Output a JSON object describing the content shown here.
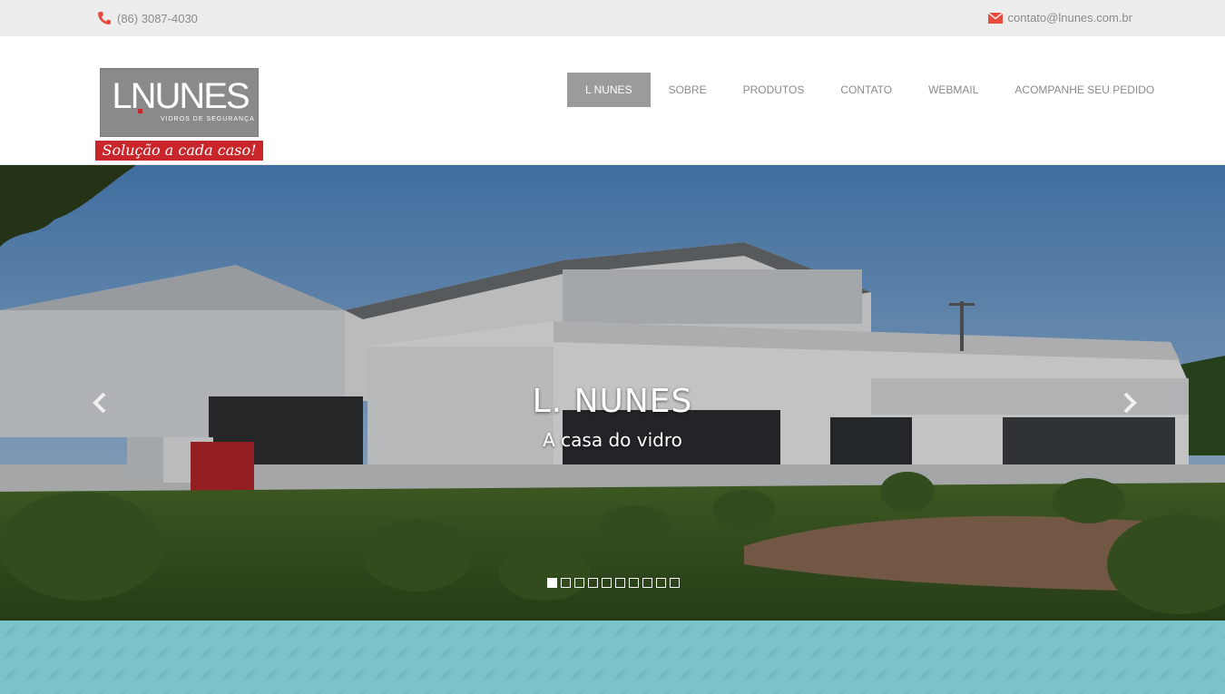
{
  "topbar": {
    "phone": "(86) 3087-4030",
    "phone_icon": "phone-icon",
    "email": "contato@lnunes.com.br",
    "email_icon": "envelope-icon"
  },
  "logo": {
    "word": "LNUNES",
    "subtitle": "VIDROS DE SEGURANÇA",
    "tagline": "Solução a cada caso!",
    "colors": {
      "grey": "#8a8a8a",
      "red": "#c9262b"
    }
  },
  "nav": {
    "items": [
      {
        "label": "L NUNES",
        "active": true
      },
      {
        "label": "SOBRE",
        "active": false
      },
      {
        "label": "PRODUTOS",
        "active": false
      },
      {
        "label": "CONTATO",
        "active": false
      },
      {
        "label": "WEBMAIL",
        "active": false
      },
      {
        "label": "ACOMPANHE SEU PEDIDO",
        "active": false
      }
    ],
    "active_color": "#9b9b9d"
  },
  "hero": {
    "title": "L. NUNES",
    "subtitle": "A casa do vidro",
    "slide_count": 10,
    "active_slide": 1,
    "prev_icon": "chevron-left-icon",
    "next_icon": "chevron-right-icon"
  },
  "band": {
    "color": "#7bc3c8"
  },
  "accent": "#e84c3d"
}
